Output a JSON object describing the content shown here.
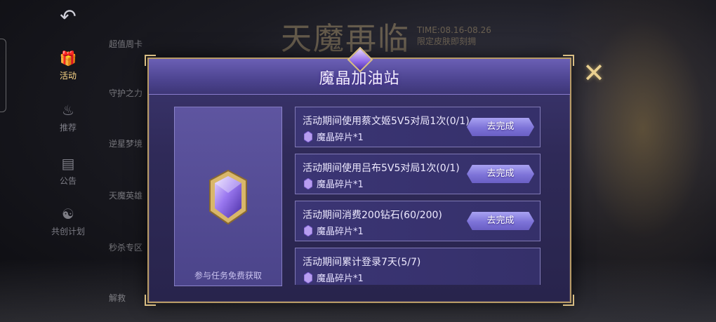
{
  "background": {
    "banner_title": "天魔再临",
    "banner_time": "TIME:08.16-08.26",
    "banner_sub": "限定皮肤即刻拥",
    "list": [
      "超值周卡",
      "守护之力",
      "逆星梦境",
      "天魔英雄",
      "秒杀专区",
      "解救"
    ]
  },
  "nav": {
    "back_icon": "back-arrow-icon",
    "items": [
      {
        "label": "活动",
        "icon": "gift-icon"
      },
      {
        "label": "推荐",
        "icon": "flame-icon"
      },
      {
        "label": "公告",
        "icon": "notice-icon"
      },
      {
        "label": "共创计划",
        "icon": "cocreate-icon"
      }
    ]
  },
  "dialog": {
    "title": "魔晶加油站",
    "reward_caption": "参与任务免费获取",
    "tasks": [
      {
        "text": "活动期间使用蔡文姬5V5对局1次(0/1)",
        "reward": "魔晶碎片*1",
        "button": "去完成"
      },
      {
        "text": "活动期间使用吕布5V5对局1次(0/1)",
        "reward": "魔晶碎片*1",
        "button": "去完成"
      },
      {
        "text": "活动期间消费200钻石(60/200)",
        "reward": "魔晶碎片*1",
        "button": "去完成"
      },
      {
        "text": "活动期间累计登录7天(5/7)",
        "reward": "魔晶碎片*1",
        "button": ""
      }
    ]
  },
  "colors": {
    "dialog_bg": "#2f2a58",
    "frame_gold": "#b79a66",
    "button_purple": "#7d73d8"
  }
}
